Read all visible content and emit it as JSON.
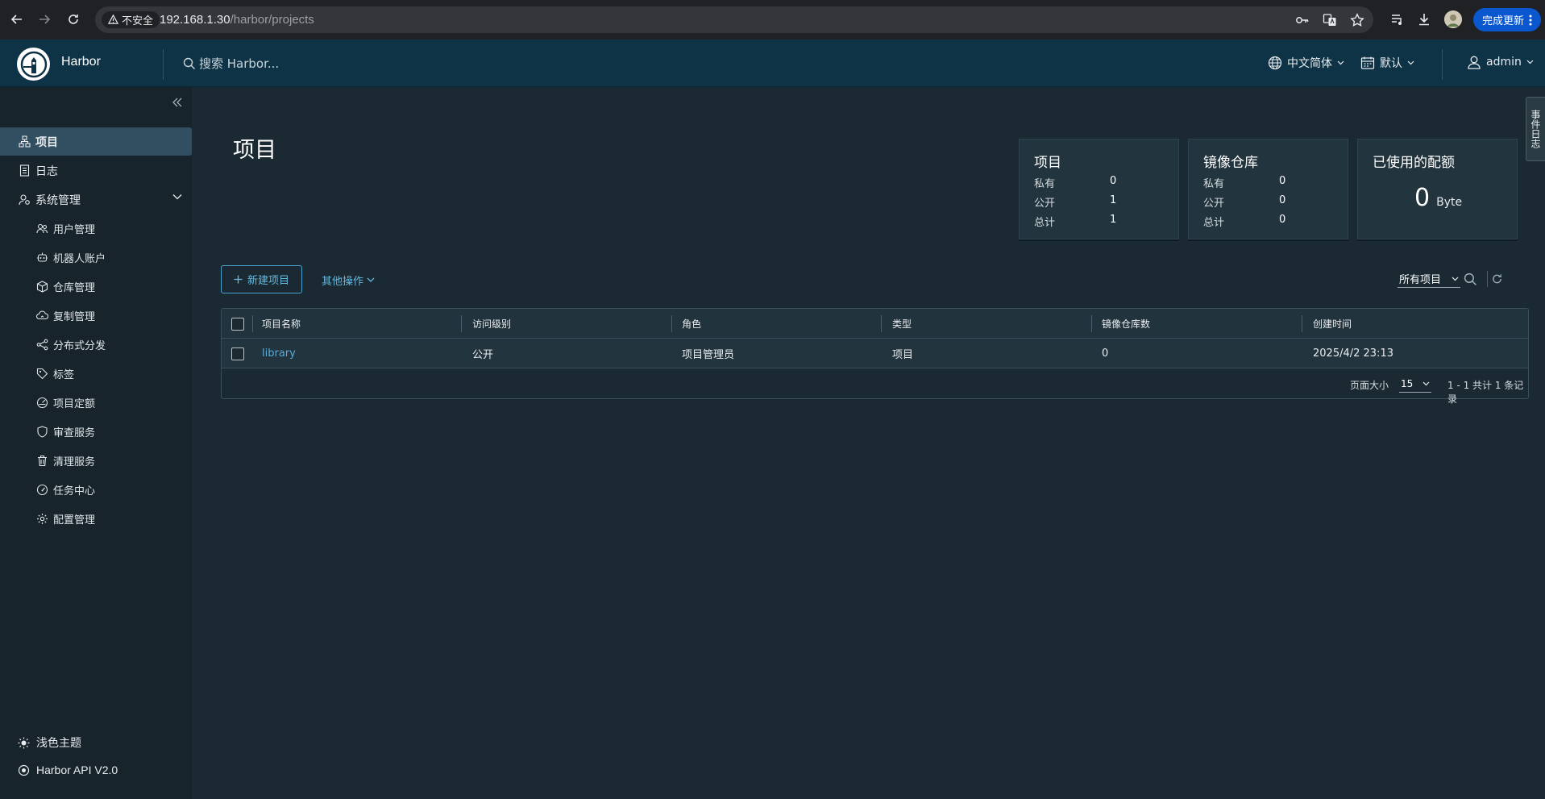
{
  "browser": {
    "security_label": "不安全",
    "url_host": "192.168.1.30",
    "url_path": "/harbor/projects",
    "update_label": "完成更新"
  },
  "header": {
    "brand": "Harbor",
    "search_placeholder": "搜索 Harbor...",
    "language": "中文简体",
    "datetime_format": "默认",
    "user": "admin"
  },
  "sidebar": {
    "items": [
      {
        "label": "项目",
        "icon": "projects-icon",
        "active": true
      },
      {
        "label": "日志",
        "icon": "logs-icon"
      },
      {
        "label": "系统管理",
        "icon": "admin-icon",
        "expandable": true
      }
    ],
    "sub_items": [
      {
        "label": "用户管理",
        "icon": "users-icon"
      },
      {
        "label": "机器人账户",
        "icon": "robot-icon"
      },
      {
        "label": "仓库管理",
        "icon": "registry-icon"
      },
      {
        "label": "复制管理",
        "icon": "replication-icon"
      },
      {
        "label": "分布式分发",
        "icon": "distribution-icon"
      },
      {
        "label": "标签",
        "icon": "tag-icon"
      },
      {
        "label": "项目定额",
        "icon": "quota-icon"
      },
      {
        "label": "审查服务",
        "icon": "shield-icon"
      },
      {
        "label": "清理服务",
        "icon": "trash-icon"
      },
      {
        "label": "任务中心",
        "icon": "dashboard-icon"
      },
      {
        "label": "配置管理",
        "icon": "gear-icon"
      }
    ],
    "theme_toggle": "浅色主题",
    "api_link": "Harbor API V2.0"
  },
  "main": {
    "title": "项目",
    "cards": {
      "projects": {
        "title": "项目",
        "private_label": "私有",
        "private": "0",
        "public_label": "公开",
        "public": "1",
        "total_label": "总计",
        "total": "1"
      },
      "repositories": {
        "title": "镜像仓库",
        "private_label": "私有",
        "private": "0",
        "public_label": "公开",
        "public": "0",
        "total_label": "总计",
        "total": "0"
      },
      "quota": {
        "title": "已使用的配额",
        "value": "0",
        "unit": "Byte"
      }
    },
    "new_project_label": "新建项目",
    "more_actions_label": "其他操作",
    "filter_selected": "所有项目",
    "side_tab": "事件日志"
  },
  "table": {
    "columns": [
      "项目名称",
      "访问级别",
      "角色",
      "类型",
      "镜像仓库数",
      "创建时间"
    ],
    "rows": [
      {
        "name": "library",
        "access": "公开",
        "role": "项目管理员",
        "type": "项目",
        "repo_count": "0",
        "created": "2025/4/2 23:13"
      }
    ],
    "page_size_label": "页面大小",
    "page_size": "15",
    "summary": "1 - 1 共计 1 条记录"
  },
  "colors": {
    "header_bg": "#0e3346",
    "sidebar_bg": "#17242b",
    "content_bg": "#1b2a32",
    "accent": "#5aabd7",
    "active_nav": "#324f61"
  }
}
